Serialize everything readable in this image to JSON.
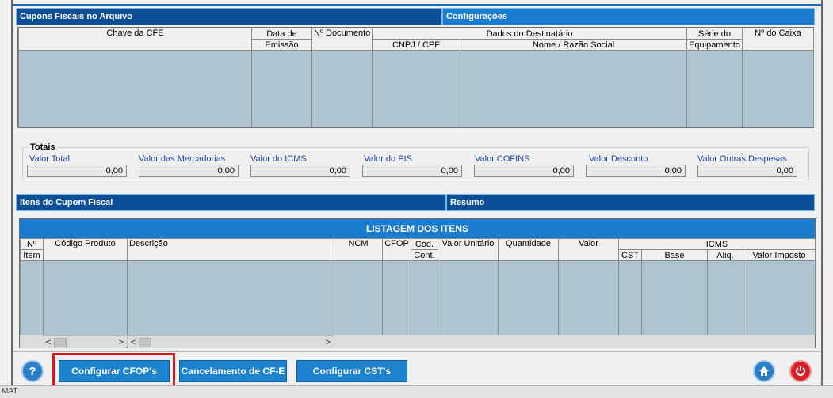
{
  "top_tabs": {
    "active": "Cupons Fiscais no Arquivo",
    "inactive": "Configurações"
  },
  "cfe_table": {
    "headers": {
      "chave": "Chave da CFE",
      "data_line1": "Data de",
      "data_line2": "Emissão",
      "documento": "Nº Documento",
      "destinatario": "Dados do Destinatário",
      "cnpj": "CNPJ / CPF",
      "nome": "Nome / Razão Social",
      "serie_line1": "Série do",
      "serie_line2": "Equipamento",
      "caixa": "Nº do Caixa"
    }
  },
  "totais": {
    "title": "Totais",
    "fields": [
      {
        "label": "Valor Total",
        "value": "0,00"
      },
      {
        "label": "Valor das Mercadorias",
        "value": "0,00"
      },
      {
        "label": "Valor do ICMS",
        "value": "0,00"
      },
      {
        "label": "Valor do PIS",
        "value": "0,00"
      },
      {
        "label": "Valor COFINS",
        "value": "0,00"
      },
      {
        "label": "Valor Desconto",
        "value": "0,00"
      },
      {
        "label": "Valor Outras Despesas",
        "value": "0,00"
      }
    ]
  },
  "item_tabs": {
    "active": "Itens do Cupom Fiscal",
    "inactive": "Resumo"
  },
  "itens_table": {
    "title": "LISTAGEM DOS ITENS",
    "headers": {
      "item_line1": "Nº",
      "item_line2": "Item",
      "codigo": "Código Produto",
      "descricao": "Descrição",
      "ncm": "NCM",
      "cfop": "CFOP",
      "cod_line1": "Cód.",
      "cod_line2": "Cont.",
      "valor_unitario": "Valor Unitário",
      "quantidade": "Quantidade",
      "valor": "Valor",
      "icms": "ICMS",
      "cst": "CST",
      "base": "Base",
      "aliq": "Aliq.",
      "valor_imposto": "Valor Imposto"
    }
  },
  "buttons": {
    "configurar_cfop": "Configurar CFOP's",
    "cancelamento": "Cancelamento de CF-E",
    "configurar_cst": "Configurar CST's"
  },
  "icons": {
    "help": "help-icon",
    "home": "home-icon",
    "power": "power-icon"
  },
  "colors": {
    "tab_active": "#0d4f96",
    "tab_inactive": "#1a7ccf",
    "grid_body": "#aec4cf",
    "highlight": "#e0141b"
  },
  "status_bar": {
    "left_text": "MAT"
  }
}
